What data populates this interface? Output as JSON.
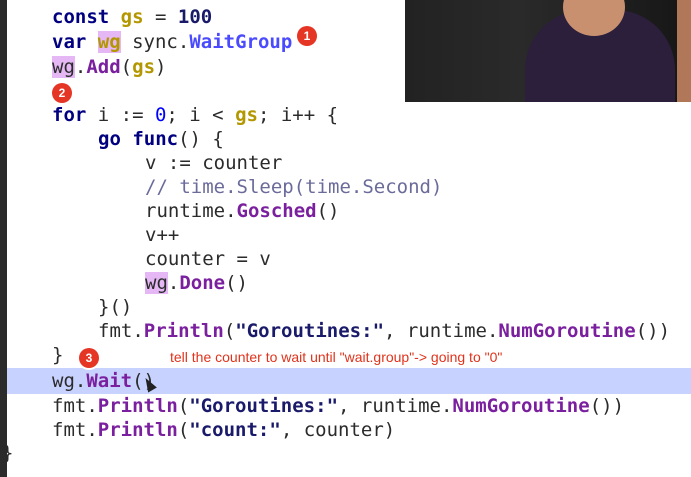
{
  "code": {
    "l1": {
      "kw": "const",
      "var": "gs",
      "op": " = ",
      "num": "100"
    },
    "l2": {
      "kw": "var",
      "var": "wg",
      "plain": " sync.",
      "type": "WaitGroup"
    },
    "l3": {
      "var": "wg",
      "dot": ".",
      "fn": "Add",
      "open": "(",
      "arg": "gs",
      "close": ")"
    },
    "l4": {
      "kw": "for",
      "a": " i := ",
      "num0": "0",
      "b": "; i < ",
      "var": "gs",
      "c": "; i++ {"
    },
    "l5": {
      "kw": "go",
      "fn": "func",
      "rest": "() {"
    },
    "l6": {
      "text": "v := counter"
    },
    "l7": {
      "text": "// time.Sleep(time.Second)"
    },
    "l8": {
      "obj": "runtime.",
      "fn": "Gosched",
      "rest": "()"
    },
    "l9": {
      "text": "v++"
    },
    "l10": {
      "text": "counter = v"
    },
    "l11": {
      "var": "wg",
      "dot": ".",
      "fn": "Done",
      "rest": "()"
    },
    "l12": {
      "text": "}()"
    },
    "l13": {
      "obj": "fmt.",
      "fn": "Println",
      "open": "(",
      "str": "\"Goroutines:\"",
      "mid": ", runtime.",
      "fn2": "NumGoroutine",
      "rest": "())"
    },
    "l14": {
      "text": "}"
    },
    "l15": {
      "var": "wg",
      "dot": ".",
      "fn": "Wait",
      "rest": "()"
    },
    "l16": {
      "obj": "fmt.",
      "fn": "Println",
      "open": "(",
      "str": "\"Goroutines:\"",
      "mid": ", runtime.",
      "fn2": "NumGoroutine",
      "rest": "())"
    },
    "l17": {
      "obj": "fmt.",
      "fn": "Println",
      "open": "(",
      "str": "\"count:\"",
      "rest": ", counter)"
    },
    "l18": {
      "text": "}"
    }
  },
  "badges": {
    "b1": "1",
    "b2": "2",
    "b3": "3"
  },
  "annotation": "tell the counter to wait until \"wait.group\"->  going to \"0\"",
  "colors": {
    "badge": "#e53525",
    "highlight_row": "#c8d2ff",
    "annotation": "#e0331c"
  }
}
